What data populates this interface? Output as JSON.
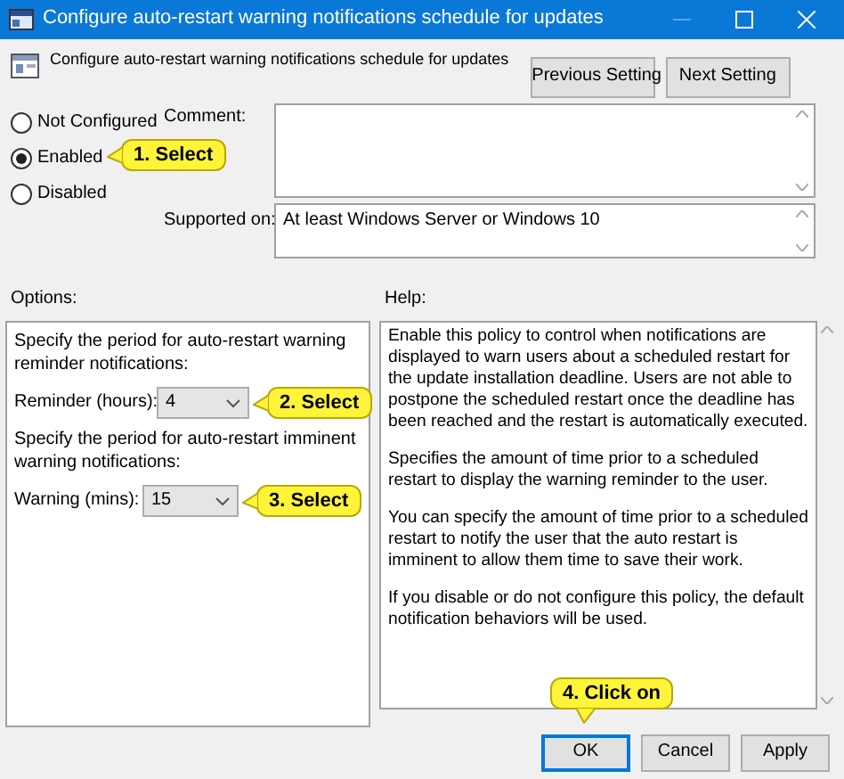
{
  "window": {
    "title": "Configure auto-restart warning notifications schedule for updates"
  },
  "header": {
    "title": "Configure auto-restart warning notifications schedule for updates",
    "buttons": [
      {
        "label": "Previous Setting"
      },
      {
        "label": "Next Setting"
      }
    ]
  },
  "state_options": [
    {
      "label": "Not Configured",
      "selected": false
    },
    {
      "label": "Enabled",
      "selected": true,
      "callout": "1. Select"
    },
    {
      "label": "Disabled",
      "selected": false
    }
  ],
  "comment": {
    "label": "Comment:"
  },
  "supported_on": {
    "label": "Supported on:",
    "value": "At least Windows Server or Windows 10"
  },
  "options": {
    "label": "Options:",
    "items": [
      {
        "kind": "text",
        "text": "Specify the period for auto-restart warning reminder notifications:"
      },
      {
        "kind": "dropdown",
        "label": "Reminder (hours):",
        "value": "4",
        "callout": "2. Select"
      },
      {
        "kind": "text",
        "text": "Specify the period for auto-restart imminent warning notifications:"
      },
      {
        "kind": "dropdown",
        "label": "Warning (mins):",
        "value": "15",
        "callout": "3. Select"
      }
    ]
  },
  "help": {
    "label": "Help:",
    "paragraphs": [
      "Enable this policy to control when notifications are displayed to warn users about a scheduled restart for the update installation deadline. Users are not able to postpone the scheduled restart once the deadline has been reached and the restart is automatically executed.",
      "Specifies the amount of time prior to a scheduled restart to display the warning reminder to the user.",
      "You can specify the amount of time prior to a scheduled restart to notify the user that the auto restart is imminent to allow them time to save their work.",
      "If you disable or do not configure this policy, the default notification behaviors will be used."
    ]
  },
  "buttons": [
    {
      "label": "OK",
      "default": true,
      "callout": "4. Click on"
    },
    {
      "label": "Cancel",
      "default": false
    },
    {
      "label": "Apply",
      "default": false
    }
  ]
}
